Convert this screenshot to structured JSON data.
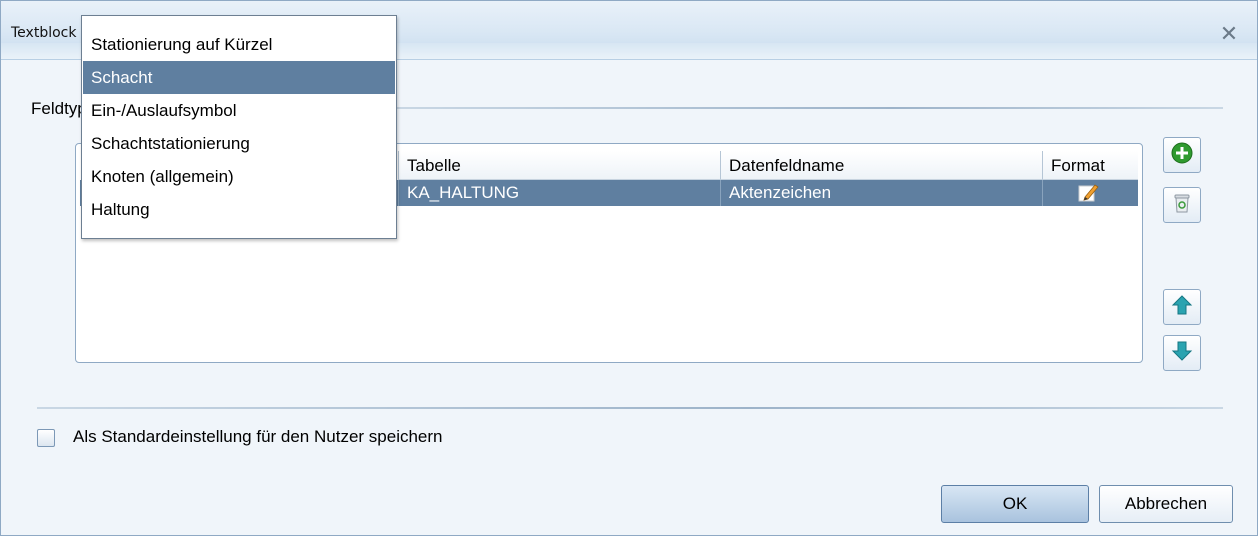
{
  "window": {
    "title": "Textblock",
    "close_symbol": "✕"
  },
  "fieldtype": {
    "label": "Feldtyp:"
  },
  "dropdown": {
    "items": [
      {
        "label": "Stationierung auf Kürzel",
        "selected": false
      },
      {
        "label": "Schacht",
        "selected": true
      },
      {
        "label": "Ein-/Auslaufsymbol",
        "selected": false
      },
      {
        "label": "Schachtstationierung",
        "selected": false
      },
      {
        "label": "Knoten (allgemein)",
        "selected": false
      },
      {
        "label": "Haltung",
        "selected": false
      }
    ]
  },
  "table": {
    "columns": [
      "Tabelle",
      "Datenfeldname",
      "Format"
    ],
    "rows": [
      {
        "tabelle": "KA_HALTUNG",
        "datenfeldname": "Aktenzeichen",
        "format_icon": "edit-pencil-icon",
        "selected": true
      }
    ]
  },
  "side_buttons": {
    "add_icon": "plus-circle-icon",
    "delete_icon": "trash-icon",
    "up_icon": "arrow-up-icon",
    "down_icon": "arrow-down-icon"
  },
  "options": {
    "save_default_label": "Als Standardeinstellung für den Nutzer speichern",
    "save_default_checked": false
  },
  "buttons": {
    "ok_label": "OK",
    "cancel_label": "Abbrechen"
  },
  "colors": {
    "selection": "#5f7fa0",
    "window_bg": "#f0f5fa",
    "border": "#8fa9c4"
  }
}
